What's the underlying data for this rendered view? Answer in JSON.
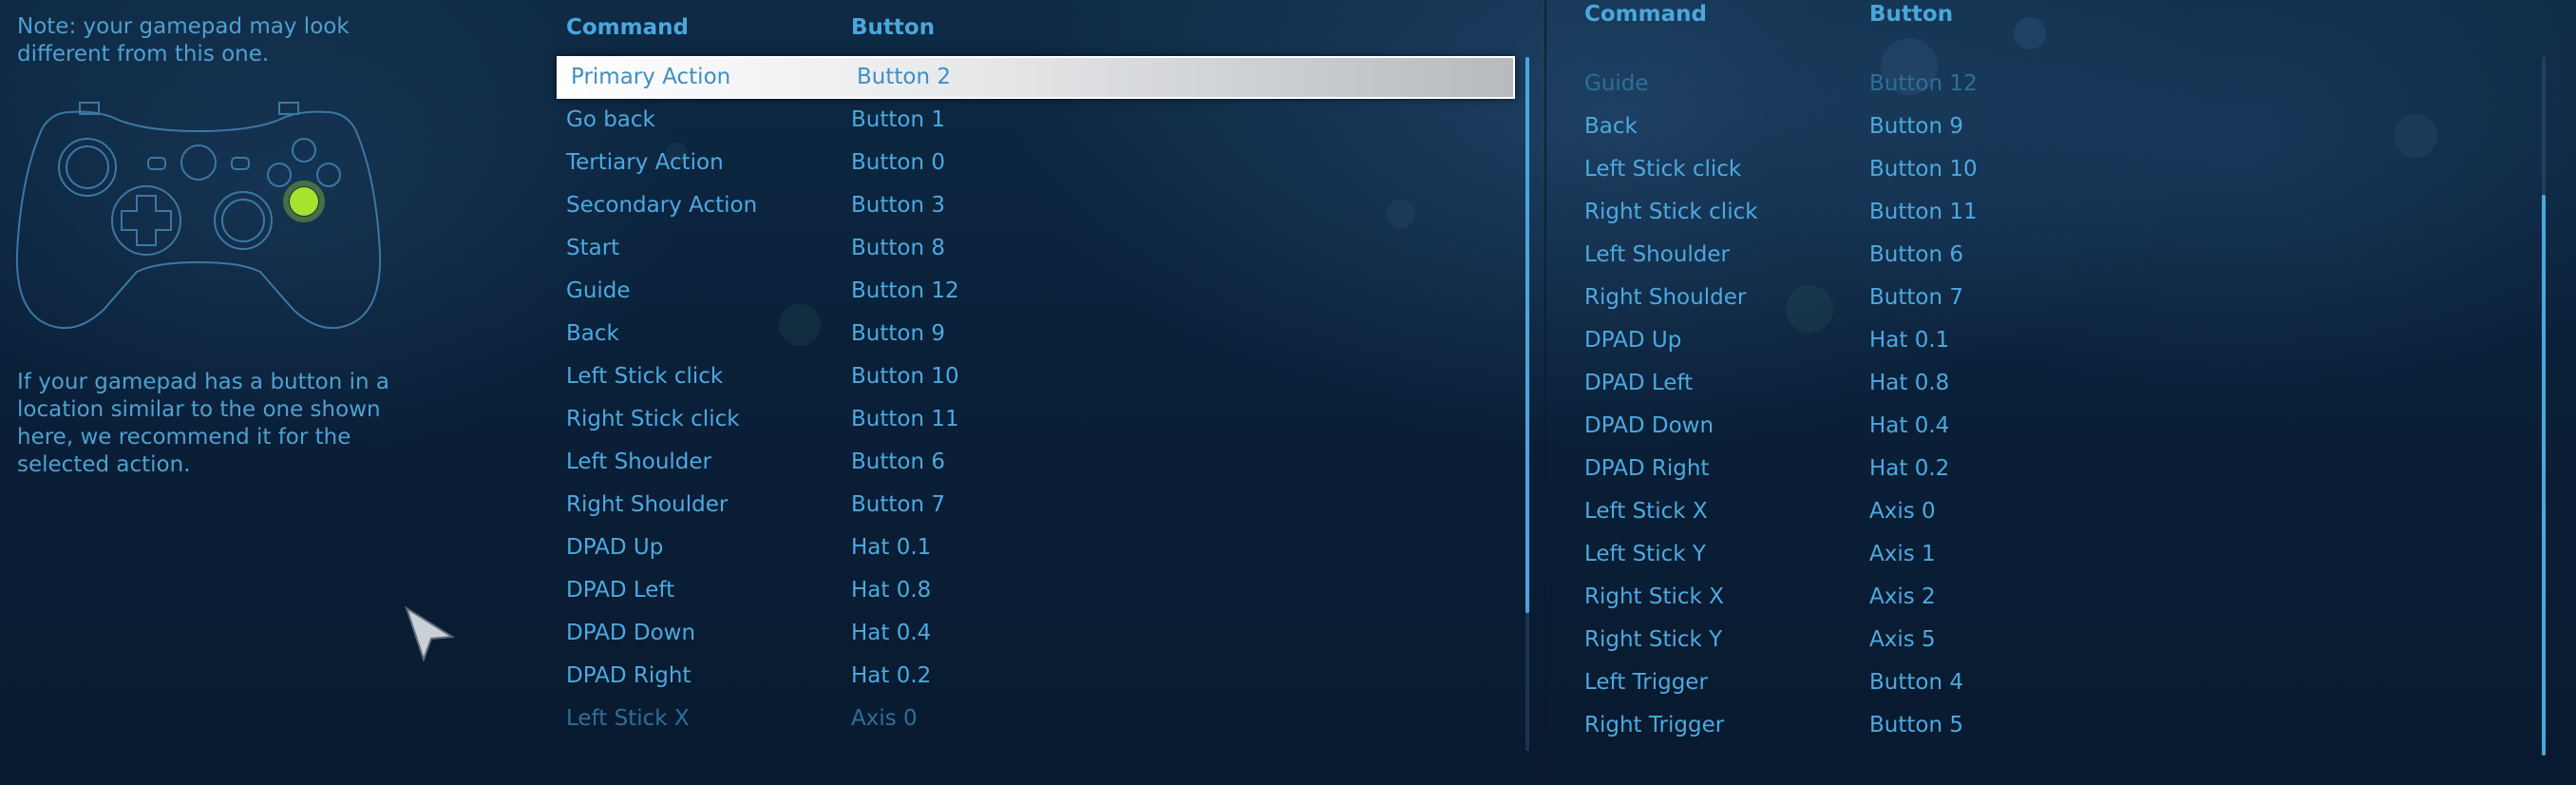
{
  "left_panel": {
    "note": "Note: your gamepad may look different from this one.",
    "info": "If your gamepad has a button in a location similar to the one shown here, we recommend it for the selected action."
  },
  "colors": {
    "accent": "#4aa7de",
    "highlight_button": "#a6e22e",
    "background": "#0a2039"
  },
  "icons": {
    "gamepad": "gamepad-outline-icon",
    "cursor": "mouse-pointer-icon"
  },
  "main_table": {
    "headers": {
      "command": "Command",
      "button": "Button"
    },
    "rows": [
      {
        "command": "Primary Action",
        "button": "Button 2",
        "selected": true
      },
      {
        "command": "Go back",
        "button": "Button 1"
      },
      {
        "command": "Tertiary Action",
        "button": "Button 0"
      },
      {
        "command": "Secondary Action",
        "button": "Button 3"
      },
      {
        "command": "Start",
        "button": "Button 8"
      },
      {
        "command": "Guide",
        "button": "Button 12"
      },
      {
        "command": "Back",
        "button": "Button 9"
      },
      {
        "command": "Left Stick click",
        "button": "Button 10"
      },
      {
        "command": "Right Stick click",
        "button": "Button 11"
      },
      {
        "command": "Left Shoulder",
        "button": "Button 6"
      },
      {
        "command": "Right Shoulder",
        "button": "Button 7"
      },
      {
        "command": "DPAD Up",
        "button": "Hat 0.1"
      },
      {
        "command": "DPAD Left",
        "button": "Hat 0.8"
      },
      {
        "command": "DPAD Down",
        "button": "Hat 0.4"
      },
      {
        "command": "DPAD Right",
        "button": "Hat 0.2"
      },
      {
        "command": "Left Stick X",
        "button": "Axis 0",
        "faded": true
      }
    ]
  },
  "second_table": {
    "headers": {
      "command": "Command",
      "button": "Button"
    },
    "rows": [
      {
        "command": "Guide",
        "button": "Button 12",
        "faded": true
      },
      {
        "command": "Back",
        "button": "Button 9"
      },
      {
        "command": "Left Stick click",
        "button": "Button 10"
      },
      {
        "command": "Right Stick click",
        "button": "Button 11"
      },
      {
        "command": "Left Shoulder",
        "button": "Button 6"
      },
      {
        "command": "Right Shoulder",
        "button": "Button 7"
      },
      {
        "command": "DPAD Up",
        "button": "Hat 0.1"
      },
      {
        "command": "DPAD Left",
        "button": "Hat 0.8"
      },
      {
        "command": "DPAD Down",
        "button": "Hat 0.4"
      },
      {
        "command": "DPAD Right",
        "button": "Hat 0.2"
      },
      {
        "command": "Left Stick X",
        "button": "Axis 0"
      },
      {
        "command": "Left Stick Y",
        "button": "Axis 1"
      },
      {
        "command": "Right Stick X",
        "button": "Axis 2"
      },
      {
        "command": "Right Stick Y",
        "button": "Axis 5"
      },
      {
        "command": "Left Trigger",
        "button": "Button 4"
      },
      {
        "command": "Right Trigger",
        "button": "Button 5"
      }
    ]
  }
}
